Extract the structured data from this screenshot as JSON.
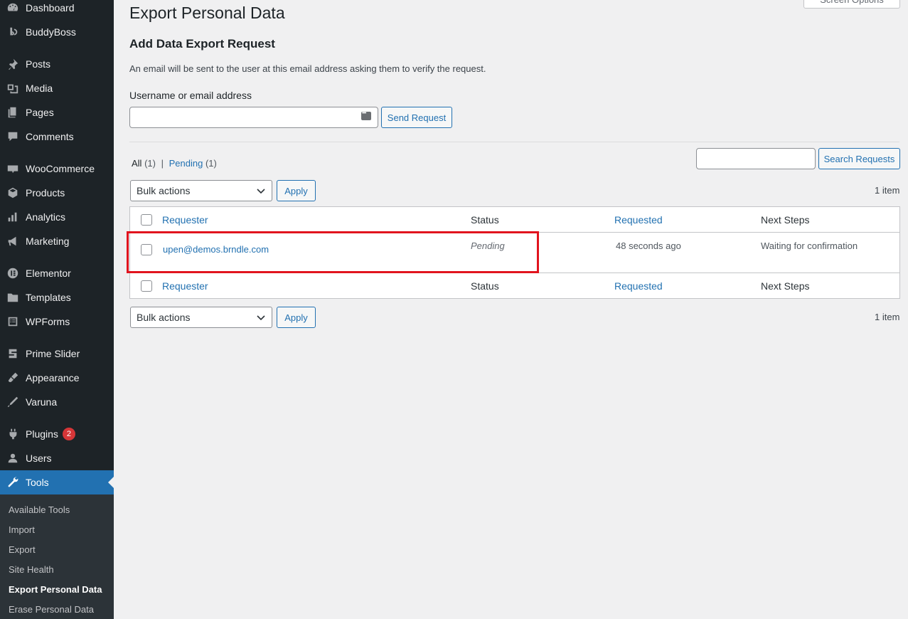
{
  "sidebar": {
    "items": [
      {
        "label": "Dashboard",
        "icon": "dashboard-icon"
      },
      {
        "label": "BuddyBoss",
        "icon": "buddyboss-icon"
      },
      {
        "label": "Posts",
        "icon": "pin-icon"
      },
      {
        "label": "Media",
        "icon": "media-icon"
      },
      {
        "label": "Pages",
        "icon": "pages-icon"
      },
      {
        "label": "Comments",
        "icon": "comment-icon"
      },
      {
        "label": "WooCommerce",
        "icon": "woocommerce-icon"
      },
      {
        "label": "Products",
        "icon": "box-icon"
      },
      {
        "label": "Analytics",
        "icon": "bar-chart-icon"
      },
      {
        "label": "Marketing",
        "icon": "megaphone-icon"
      },
      {
        "label": "Elementor",
        "icon": "elementor-icon"
      },
      {
        "label": "Templates",
        "icon": "folder-icon"
      },
      {
        "label": "WPForms",
        "icon": "form-icon"
      },
      {
        "label": "Prime Slider",
        "icon": "slider-icon"
      },
      {
        "label": "Appearance",
        "icon": "brush-icon"
      },
      {
        "label": "Varuna",
        "icon": "pen-icon"
      },
      {
        "label": "Plugins",
        "icon": "plugin-icon",
        "badge": "2"
      },
      {
        "label": "Users",
        "icon": "user-icon"
      },
      {
        "label": "Tools",
        "icon": "wrench-icon",
        "active": true
      }
    ],
    "submenu": [
      {
        "label": "Available Tools"
      },
      {
        "label": "Import"
      },
      {
        "label": "Export"
      },
      {
        "label": "Site Health"
      },
      {
        "label": "Export Personal Data",
        "current": true
      },
      {
        "label": "Erase Personal Data"
      }
    ]
  },
  "header": {
    "screen_options": "Screen Options",
    "page_title": "Export Personal Data"
  },
  "form": {
    "section_title": "Add Data Export Request",
    "description": "An email will be sent to the user at this email address asking them to verify the request.",
    "field_label": "Username or email address",
    "field_value": "",
    "submit_label": "Send Request"
  },
  "filters": {
    "all_label": "All",
    "all_count": "(1)",
    "separator": "|",
    "pending_label": "Pending",
    "pending_count": "(1)",
    "search_value": "",
    "search_button": "Search Requests"
  },
  "bulk": {
    "select_label": "Bulk actions",
    "apply_label": "Apply",
    "item_count": "1 item"
  },
  "table": {
    "columns": [
      "Requester",
      "Status",
      "Requested",
      "Next Steps"
    ],
    "rows": [
      {
        "requester": "upen@demos.brndle.com",
        "status": "Pending",
        "requested": "48 seconds ago",
        "next_steps": "Waiting for confirmation"
      }
    ]
  },
  "colors": {
    "accent": "#2271b1",
    "sidebar_bg": "#1d2327",
    "highlight_box": "#e1141e",
    "badge": "#d63638"
  }
}
